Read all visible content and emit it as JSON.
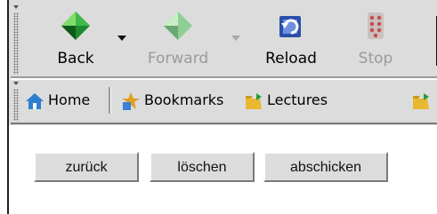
{
  "nav_toolbar": {
    "back_label": "Back",
    "forward_label": "Forward",
    "reload_label": "Reload",
    "stop_label": "Stop"
  },
  "bookmarks_toolbar": {
    "home_label": "Home",
    "bookmarks_label": "Bookmarks",
    "lectures_label": "Lectures"
  },
  "form": {
    "back_button": "zurück",
    "clear_button": "löschen",
    "submit_button": "abschicken"
  },
  "colors": {
    "chrome_bg": "#dcdcdc",
    "disabled_text": "#9a9a9a"
  }
}
